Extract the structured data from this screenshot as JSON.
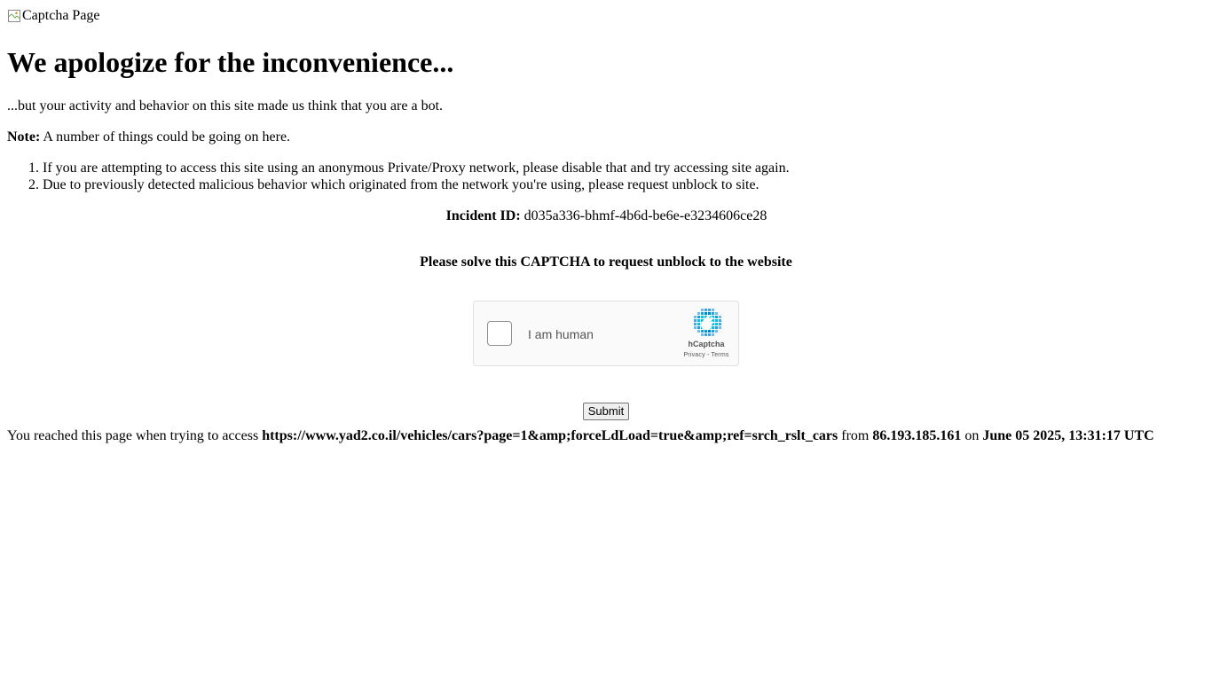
{
  "logo": {
    "alt": "Captcha Page",
    "icon": "broken-image-icon"
  },
  "heading": "We apologize for the inconvenience...",
  "intro": "...but your activity and behavior on this site made us think that you are a bot.",
  "note": {
    "label": "Note:",
    "text": " A number of things could be going on here."
  },
  "reasons": [
    "If you are attempting to access this site using an anonymous Private/Proxy network, please disable that and try accessing site again.",
    "Due to previously detected malicious behavior which originated from the network you're using, please request unblock to site."
  ],
  "incident": {
    "label": "Incident ID:",
    "value": " d035a336-bhmf-4b6d-be6e-e3234606ce28"
  },
  "captcha_prompt": "Please solve this CAPTCHA to request unblock to the website",
  "hcaptcha": {
    "label": "I am human",
    "brand": "hCaptcha",
    "privacy": "Privacy",
    "separator": " - ",
    "terms": "Terms",
    "logo_icon": "hcaptcha-logo-icon"
  },
  "submit_label": "Submit",
  "footer": {
    "prefix": "You reached this page when trying to access ",
    "url": "https://www.yad2.co.il/vehicles/cars?page=1&amp;forceLdLoad=true&amp;ref=srch_rslt_cars",
    "from_text": " from ",
    "ip": "86.193.185.161",
    "on_text": " on ",
    "datetime": "June 05 2025, 13:31:17 UTC"
  },
  "colors": {
    "text": "#000000",
    "hcaptcha_bg": "#fafafa",
    "hcaptcha_border": "#e0e0e0",
    "hcaptcha_text": "#555555",
    "hcaptcha_logo_primary": "#1fb7d4",
    "hcaptcha_logo_secondary": "#0074bf"
  }
}
